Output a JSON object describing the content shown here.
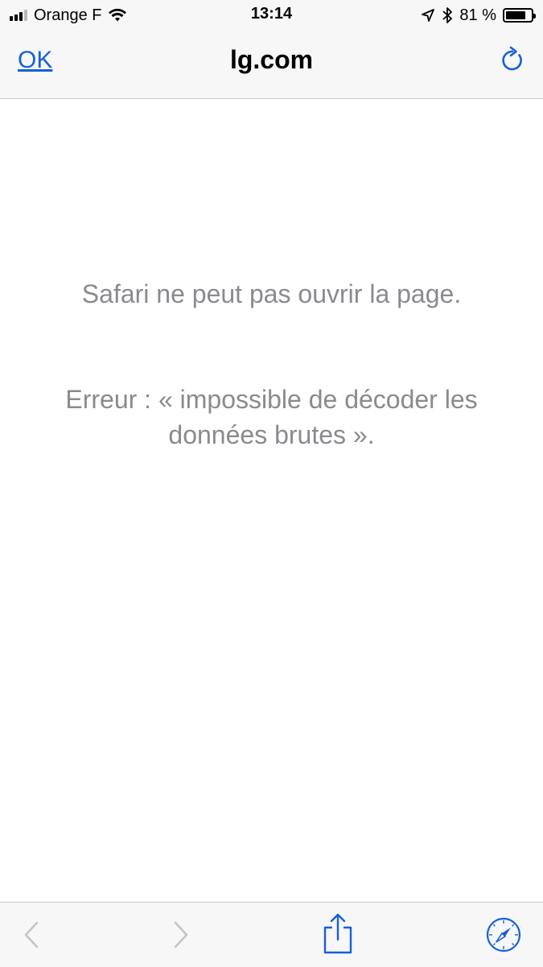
{
  "status_bar": {
    "carrier": "Orange F",
    "time": "13:14",
    "battery_percent": "81 %",
    "battery_level": 0.81,
    "signal_bars_active": 3,
    "signal_bars_total": 4,
    "icons": [
      "cellular-signal-icon",
      "wifi-icon",
      "location-arrow-icon",
      "bluetooth-icon",
      "battery-icon"
    ]
  },
  "navbar": {
    "done_label": "OK",
    "title": "lg.com",
    "reload_icon": "reload-icon"
  },
  "error": {
    "line1": "Safari ne peut pas ouvrir la page.",
    "line2": "Erreur : « impossible de décoder les données brutes »."
  },
  "toolbar": {
    "icons": [
      "back-chevron-icon",
      "forward-chevron-icon",
      "share-icon",
      "safari-compass-icon"
    ]
  },
  "colors": {
    "accent": "#1560d8",
    "message_text": "#8a8a8f",
    "bar_background": "#f7f7f7"
  }
}
